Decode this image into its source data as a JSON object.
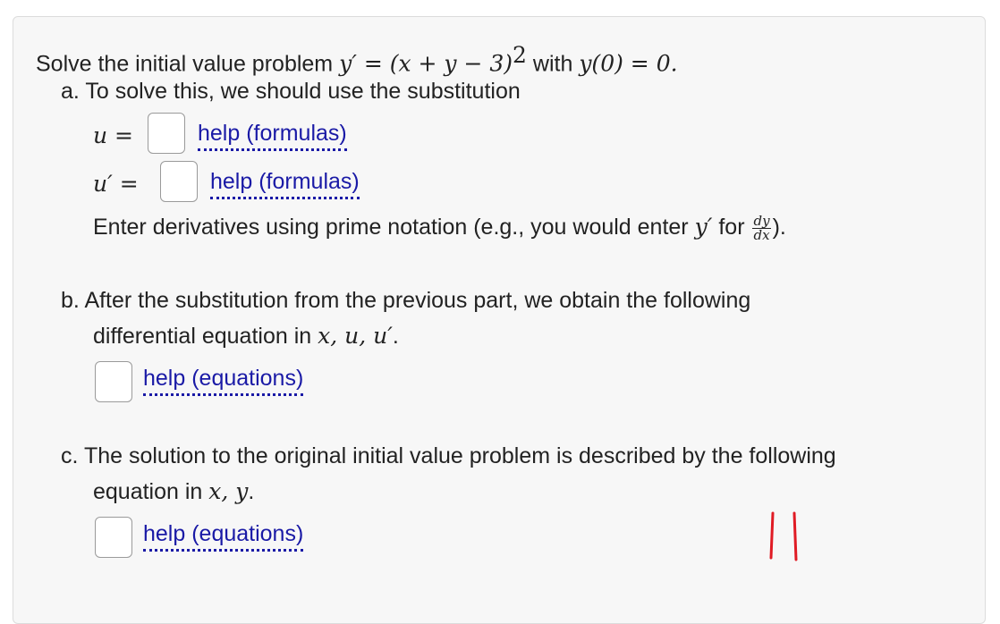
{
  "problem": {
    "intro_text": "Solve the initial value problem ",
    "equation": "y′ = (x + y − 3)",
    "exponent": "2",
    "with_text": " with ",
    "initial_condition": "y(0) = 0."
  },
  "part_a": {
    "label": "a.",
    "text": "To solve this, we should use the substitution",
    "u_label": "u =",
    "u_prime_label": "u′ =",
    "help_u": "help (formulas)",
    "help_u_prime": "help (formulas)",
    "note_text": "Enter derivatives using prime notation (e.g., you would enter ",
    "note_y_prime": "y′",
    "note_for": " for ",
    "frac_num": "dy",
    "frac_den": "dx",
    "note_end": ")."
  },
  "part_b": {
    "label": "b.",
    "text_line1": "After the substitution from the previous part, we obtain the following",
    "text_line2": "differential equation in ",
    "vars": "x, u, u′",
    "period": ".",
    "help": "help (equations)"
  },
  "part_c": {
    "label": "c.",
    "text_line1": "The solution to the original initial value problem is described by the following",
    "text_line2": "equation in ",
    "vars": "x, y",
    "period": ".",
    "help": "help (equations)"
  },
  "colors": {
    "link": "#1a1aa6",
    "annotation": "#e01b24"
  }
}
